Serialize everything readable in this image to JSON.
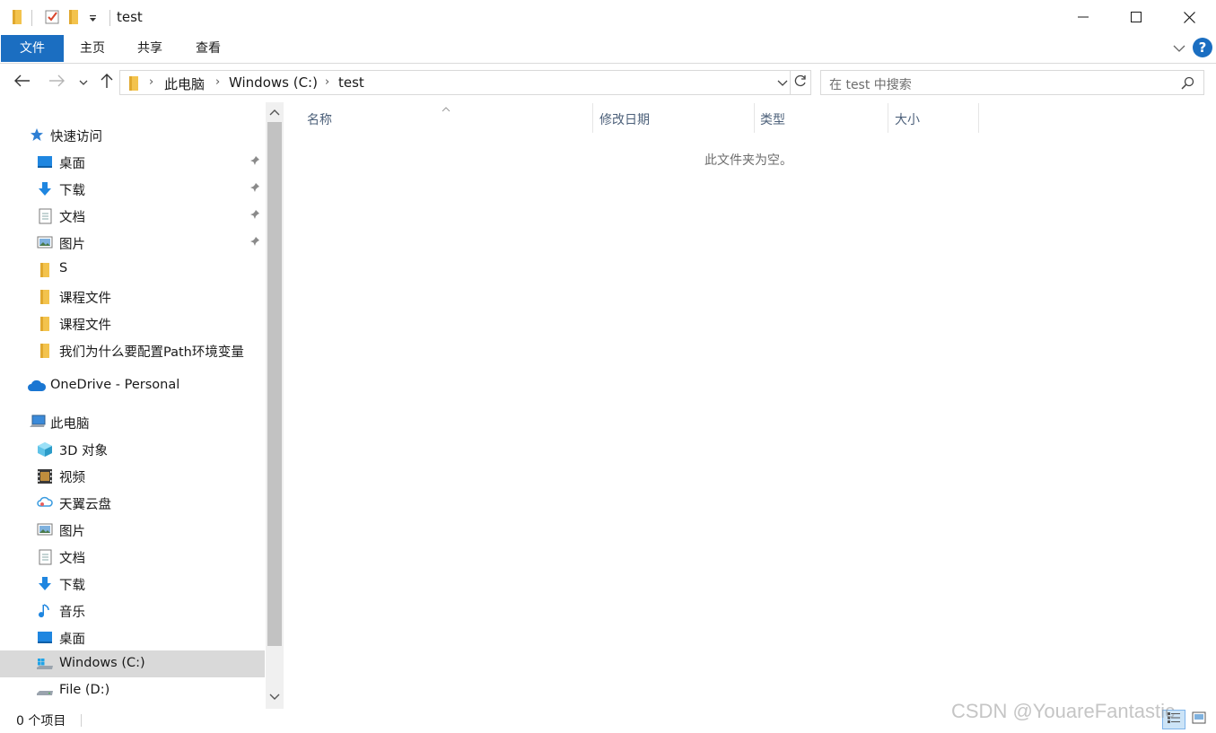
{
  "window": {
    "title": "test",
    "minimize_icon": "minimize-icon",
    "maximize_icon": "maximize-icon",
    "close_icon": "close-icon"
  },
  "ribbon": {
    "tabs": [
      {
        "label": "文件",
        "active": true
      },
      {
        "label": "主页"
      },
      {
        "label": "共享"
      },
      {
        "label": "查看"
      }
    ],
    "help_label": "?"
  },
  "address": {
    "breadcrumbs": [
      "此电脑",
      "Windows (C:)",
      "test"
    ],
    "search_placeholder": "在 test 中搜索"
  },
  "sidebar": {
    "quick_access": {
      "label": "快速访问",
      "items": [
        {
          "label": "桌面",
          "icon": "desktop-icon",
          "pinned": true
        },
        {
          "label": "下载",
          "icon": "download-icon",
          "pinned": true
        },
        {
          "label": "文档",
          "icon": "document-icon",
          "pinned": true
        },
        {
          "label": "图片",
          "icon": "pictures-icon",
          "pinned": true
        },
        {
          "label": "S",
          "icon": "folder-icon"
        },
        {
          "label": "课程文件",
          "icon": "folder-icon"
        },
        {
          "label": "课程文件",
          "icon": "folder-icon"
        },
        {
          "label": "我们为什么要配置Path环境变量",
          "icon": "folder-icon"
        }
      ]
    },
    "onedrive": {
      "label": "OneDrive - Personal",
      "icon": "onedrive-cloud-icon"
    },
    "this_pc": {
      "label": "此电脑",
      "items": [
        {
          "label": "3D 对象",
          "icon": "3d-objects-icon"
        },
        {
          "label": "视频",
          "icon": "video-icon"
        },
        {
          "label": "天翼云盘",
          "icon": "cloud-drive-icon"
        },
        {
          "label": "图片",
          "icon": "pictures-icon"
        },
        {
          "label": "文档",
          "icon": "document-icon"
        },
        {
          "label": "下载",
          "icon": "download-icon"
        },
        {
          "label": "音乐",
          "icon": "music-icon"
        },
        {
          "label": "桌面",
          "icon": "desktop-icon"
        },
        {
          "label": "Windows (C:)",
          "icon": "windows-drive-icon",
          "selected": true
        },
        {
          "label": "File (D:)",
          "icon": "drive-icon"
        }
      ]
    }
  },
  "content": {
    "columns": [
      "名称",
      "修改日期",
      "类型",
      "大小"
    ],
    "empty_message": "此文件夹为空。"
  },
  "status": {
    "item_count": "0 个项目"
  },
  "watermark": "CSDN @YouareFantastic",
  "colors": {
    "accent": "#1b6ec1",
    "folder": "#f3c34d",
    "selected": "#d9d9d9"
  }
}
